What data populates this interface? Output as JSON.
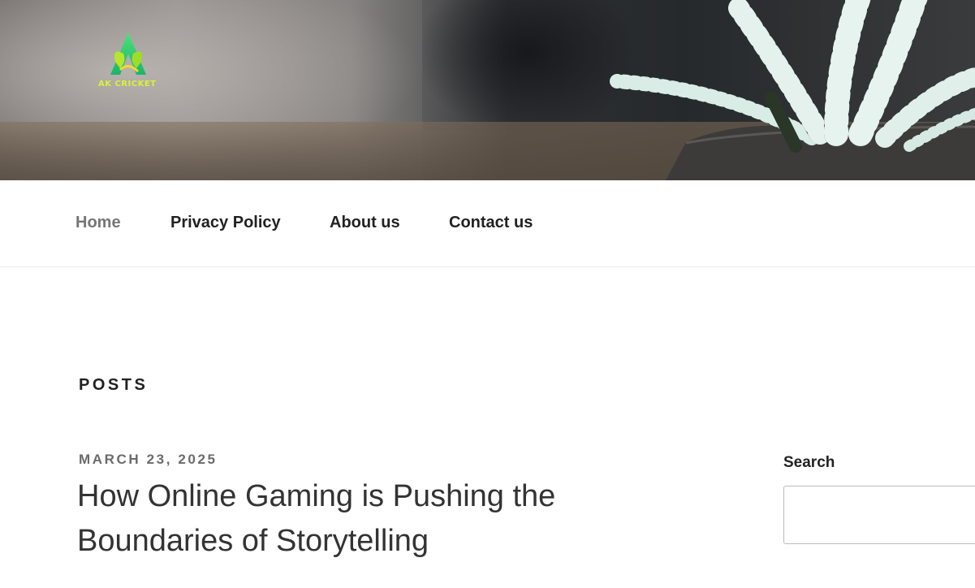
{
  "header": {
    "logo_text": "AK CRICKET",
    "banner_image": "aloe-plant-photo"
  },
  "nav": {
    "items": [
      {
        "label": "Home",
        "active": true
      },
      {
        "label": "Privacy Policy",
        "active": false
      },
      {
        "label": "About us",
        "active": false
      },
      {
        "label": "Contact us",
        "active": false
      }
    ]
  },
  "main": {
    "section_title": "POSTS",
    "posts": [
      {
        "date": "MARCH 23, 2025",
        "title": "How Online Gaming is Pushing the Boundaries of Storytelling"
      }
    ]
  },
  "sidebar": {
    "search_title": "Search",
    "search_value": "",
    "search_placeholder": ""
  },
  "colors": {
    "nav_active": "#767676",
    "text_dark": "#222222",
    "date_gray": "#6b6b6b",
    "logo_green": "#3cc34a",
    "logo_yellow": "#d7f23a"
  }
}
